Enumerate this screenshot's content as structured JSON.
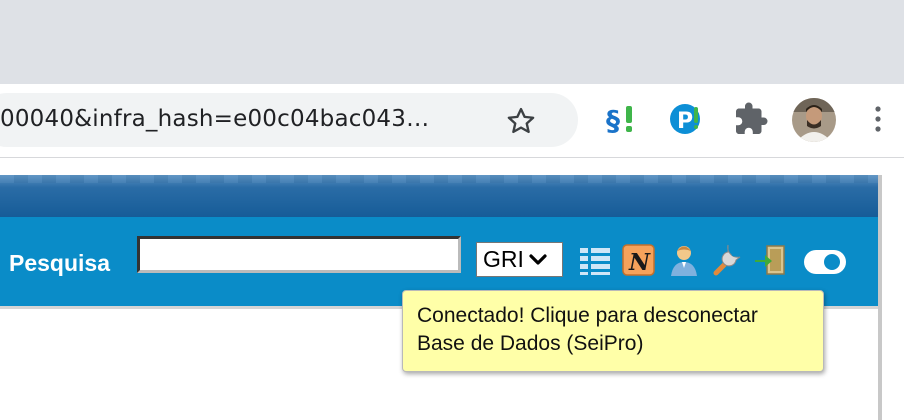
{
  "browser": {
    "url_text": "00040&infra_hash=e00c04bac043…",
    "bookmark_icon": "star-icon",
    "extensions": [
      "sei-pro-extension-icon",
      "p-extension-icon",
      "puzzle-icon"
    ],
    "avatar": "profile-avatar",
    "menu_icon": "kebab-menu-icon"
  },
  "header": {
    "search_label": "Pesquisa",
    "search_value": "",
    "unit_selected": "GRI",
    "icons": [
      "list-icon",
      "n-note-icon",
      "user-icon",
      "tools-icon",
      "exit-door-icon",
      "toggle-switch-icon"
    ],
    "toggle_on": true
  },
  "tooltip": {
    "line1": "Conectado! Clique para desconectar",
    "line2": "Base de Dados (SeiPro)"
  },
  "colors": {
    "header_dark": "#165c98",
    "header_light": "#0a8cc8",
    "tooltip_bg": "#ffffa8"
  }
}
